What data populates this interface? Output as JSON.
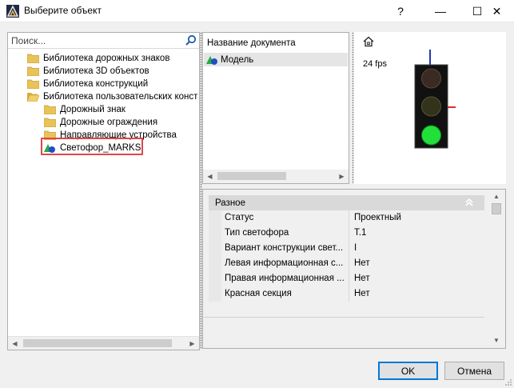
{
  "window": {
    "title": "Выберите объект",
    "help_glyph": "?",
    "minimize_glyph": "—",
    "maximize_glyph": "☐",
    "close_glyph": "✕"
  },
  "search": {
    "placeholder": "Поиск...",
    "value": ""
  },
  "tree": {
    "items": [
      {
        "label": "Библиотека дорожных знаков",
        "icon": "folder-icon"
      },
      {
        "label": "Библиотека 3D объектов",
        "icon": "folder-icon"
      },
      {
        "label": "Библиотека конструкций",
        "icon": "folder-icon"
      },
      {
        "label": "Библиотека пользовательских конст",
        "icon": "folder-icon"
      },
      {
        "label": "Дорожный знак",
        "icon": "folder-icon"
      },
      {
        "label": "Дорожные ограждения",
        "icon": "folder-icon"
      },
      {
        "label": "Направляющие устройства",
        "icon": "folder-icon"
      },
      {
        "label": "Светофор_MARKS",
        "icon": "object-icon"
      }
    ]
  },
  "documents": {
    "header": "Название документа",
    "rows": [
      {
        "label": "Модель",
        "icon": "object-icon"
      }
    ]
  },
  "preview": {
    "fps": "24 fps"
  },
  "properties": {
    "category": "Разное",
    "rows": [
      {
        "name": "Статус",
        "value": "Проектный"
      },
      {
        "name": "Тип светофора",
        "value": "Т.1"
      },
      {
        "name": "Вариант конструкции свет...",
        "value": "I"
      },
      {
        "name": "Левая информационная с...",
        "value": "Нет"
      },
      {
        "name": "Правая информационная ...",
        "value": "Нет"
      },
      {
        "name": "Красная секция",
        "value": "Нет"
      }
    ]
  },
  "buttons": {
    "ok": "OK",
    "cancel": "Отмена"
  },
  "colors": {
    "accent": "#0078d7",
    "selection_highlight": "#e0454e",
    "folder": "#e8c35a",
    "light_green": "#22e03a",
    "light_off": "#3a2a20"
  }
}
